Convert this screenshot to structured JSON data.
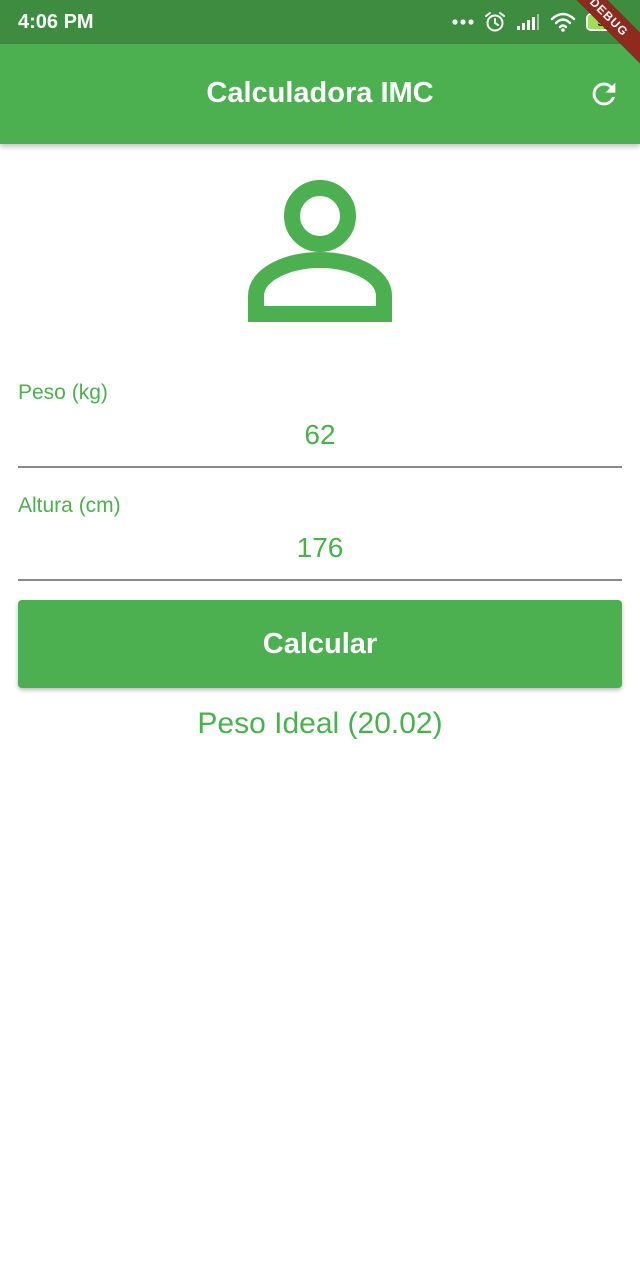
{
  "status_bar": {
    "time": "4:06 PM",
    "battery": "51",
    "icons": [
      "more-dots-icon",
      "alarm-icon",
      "signal-icon",
      "wifi-icon",
      "battery-icon"
    ]
  },
  "app_bar": {
    "title": "Calculadora IMC",
    "refresh_icon": "refresh-icon"
  },
  "debug_banner": "DEBUG",
  "avatar_icon": "person-outline-icon",
  "form": {
    "weight": {
      "label": "Peso (kg)",
      "value": "62"
    },
    "height": {
      "label": "Altura (cm)",
      "value": "176"
    },
    "button_label": "Calcular"
  },
  "result": "Peso Ideal (20.02)",
  "colors": {
    "primary": "#4caf50",
    "status_bar": "#3d8c40",
    "underline": "#8a8a8a",
    "debug": "#8e2a1e"
  }
}
